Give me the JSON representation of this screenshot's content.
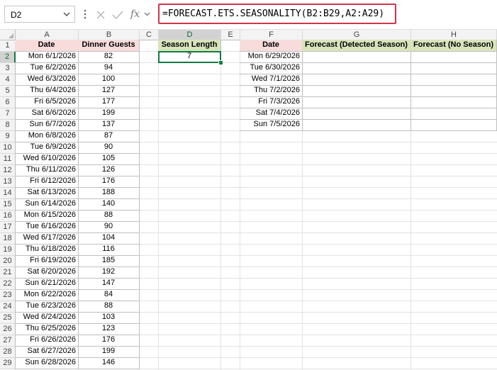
{
  "name_box": {
    "value": "D2"
  },
  "formula_bar": {
    "formula": "=FORECAST.ETS.SEASONALITY(B2:B29,A2:A29)",
    "cancel_icon": "close-icon",
    "enter_icon": "check-icon",
    "function_icon": "fx"
  },
  "columns": [
    "A",
    "B",
    "C",
    "D",
    "E",
    "F",
    "G",
    "H"
  ],
  "selected_column": "D",
  "selected_row": "2",
  "rows": [
    "1",
    "2",
    "3",
    "4",
    "5",
    "6",
    "7",
    "8",
    "9",
    "10",
    "11",
    "12",
    "13",
    "14",
    "15",
    "16",
    "17",
    "18",
    "19",
    "20",
    "21",
    "22",
    "23",
    "24",
    "25",
    "26",
    "27",
    "28",
    "29"
  ],
  "table_left": {
    "headers": {
      "date": "Date",
      "guests": "Dinner Guests"
    },
    "rows": [
      {
        "date": "Mon 6/1/2026",
        "guests": "82"
      },
      {
        "date": "Tue 6/2/2026",
        "guests": "94"
      },
      {
        "date": "Wed 6/3/2026",
        "guests": "100"
      },
      {
        "date": "Thu 6/4/2026",
        "guests": "127"
      },
      {
        "date": "Fri 6/5/2026",
        "guests": "177"
      },
      {
        "date": "Sat 6/6/2026",
        "guests": "199"
      },
      {
        "date": "Sun 6/7/2026",
        "guests": "137"
      },
      {
        "date": "Mon 6/8/2026",
        "guests": "87"
      },
      {
        "date": "Tue 6/9/2026",
        "guests": "90"
      },
      {
        "date": "Wed 6/10/2026",
        "guests": "105"
      },
      {
        "date": "Thu 6/11/2026",
        "guests": "126"
      },
      {
        "date": "Fri 6/12/2026",
        "guests": "176"
      },
      {
        "date": "Sat 6/13/2026",
        "guests": "188"
      },
      {
        "date": "Sun 6/14/2026",
        "guests": "140"
      },
      {
        "date": "Mon 6/15/2026",
        "guests": "88"
      },
      {
        "date": "Tue 6/16/2026",
        "guests": "90"
      },
      {
        "date": "Wed 6/17/2026",
        "guests": "104"
      },
      {
        "date": "Thu 6/18/2026",
        "guests": "116"
      },
      {
        "date": "Fri 6/19/2026",
        "guests": "185"
      },
      {
        "date": "Sat 6/20/2026",
        "guests": "192"
      },
      {
        "date": "Sun 6/21/2026",
        "guests": "147"
      },
      {
        "date": "Mon 6/22/2026",
        "guests": "84"
      },
      {
        "date": "Tue 6/23/2026",
        "guests": "88"
      },
      {
        "date": "Wed 6/24/2026",
        "guests": "103"
      },
      {
        "date": "Thu 6/25/2026",
        "guests": "123"
      },
      {
        "date": "Fri 6/26/2026",
        "guests": "176"
      },
      {
        "date": "Sat 6/27/2026",
        "guests": "199"
      },
      {
        "date": "Sun 6/28/2026",
        "guests": "146"
      }
    ]
  },
  "season": {
    "header": "Season Length",
    "value": "7"
  },
  "forecast": {
    "headers": {
      "date": "Date",
      "detected": "Forecast (Detected Season)",
      "none": "Forecast (No Season)"
    },
    "dates": [
      "Mon 6/29/2026",
      "Tue 6/30/2026",
      "Wed 7/1/2026",
      "Thu 7/2/2026",
      "Fri 7/3/2026",
      "Sat 7/4/2026",
      "Sun 7/5/2026"
    ]
  },
  "colors": {
    "formula_highlight": "#d1334b",
    "selection": "#107c41",
    "header_pink": "#f8dcdc",
    "header_green": "#d8e4bc"
  }
}
